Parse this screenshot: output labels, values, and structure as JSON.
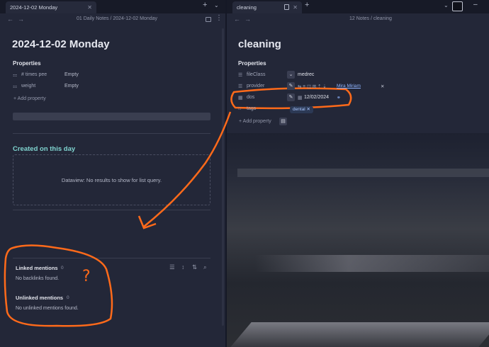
{
  "left": {
    "tab_title": "2024-12-02 Monday",
    "breadcrumb": "01 Daily Notes / 2024-12-02 Monday",
    "title": "2024-12-02 Monday",
    "properties_heading": "Properties",
    "properties": [
      {
        "key": "# times pee",
        "value": "Empty",
        "icon": "number-icon"
      },
      {
        "key": "weight",
        "value": "Empty",
        "icon": "number-icon"
      }
    ],
    "add_property": "+ Add property",
    "created_heading": "Created on this day",
    "dataview_message": "Dataview: No results to show for list query.",
    "linked_heading": "Linked mentions",
    "linked_count": "0",
    "linked_empty": "No backlinks found.",
    "unlinked_heading": "Unlinked mentions",
    "unlinked_count": "0",
    "unlinked_empty": "No unlinked mentions found."
  },
  "right": {
    "tab_title": "cleaning",
    "breadcrumb": "12 Notes / cleaning",
    "title": "cleaning",
    "properties_heading": "Properties",
    "fileclass_key": "fileClass",
    "fileclass_value": "medrec",
    "provider_key": "provider",
    "provider_links": "Mira  Miriam",
    "dos_key": "dos",
    "dos_value": "12/02/2024",
    "tags_key": "tags",
    "tags_value": "dental",
    "add_property": "+ Add property"
  },
  "annotation": {
    "question_mark": "?",
    "color": "#ff6a1a"
  },
  "colors": {
    "background": "#232738",
    "accent_heading": "#7fd4d0",
    "link": "#8fb4ff"
  }
}
